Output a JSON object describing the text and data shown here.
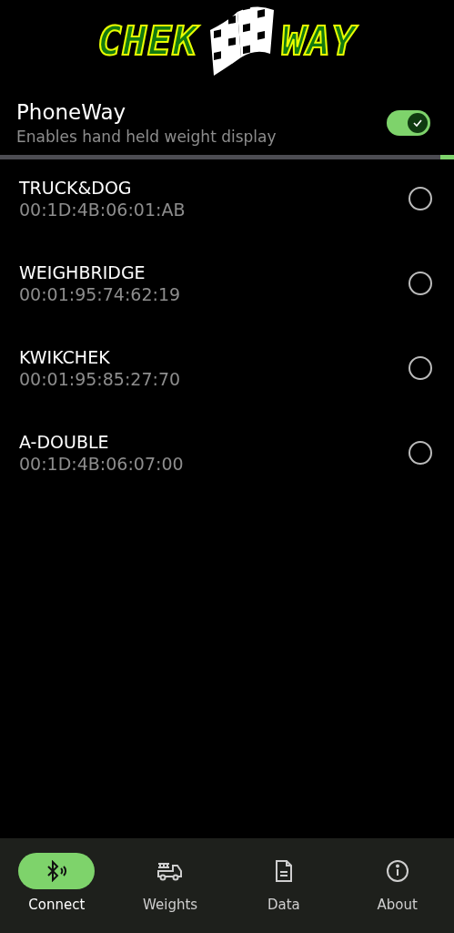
{
  "logo": {
    "left": "CHEK",
    "right": "WAY"
  },
  "setting": {
    "title": "PhoneWay",
    "subtitle": "Enables hand held weight display",
    "on": true
  },
  "scan": {
    "level": 0.03
  },
  "devices": [
    {
      "name": "TRUCK&DOG",
      "address": "00:1D:4B:06:01:AB",
      "selected": false
    },
    {
      "name": "WEIGHBRIDGE",
      "address": "00:01:95:74:62:19",
      "selected": false
    },
    {
      "name": "KWIKCHEK",
      "address": "00:01:95:85:27:70",
      "selected": false
    },
    {
      "name": "A-DOUBLE",
      "address": "00:1D:4B:06:07:00",
      "selected": false
    }
  ],
  "nav": [
    {
      "kind": "bluetooth",
      "label": "Connect",
      "selected": true
    },
    {
      "kind": "truck",
      "label": "Weights",
      "selected": false
    },
    {
      "kind": "document",
      "label": "Data",
      "selected": false
    },
    {
      "kind": "info",
      "label": "About",
      "selected": false
    }
  ]
}
